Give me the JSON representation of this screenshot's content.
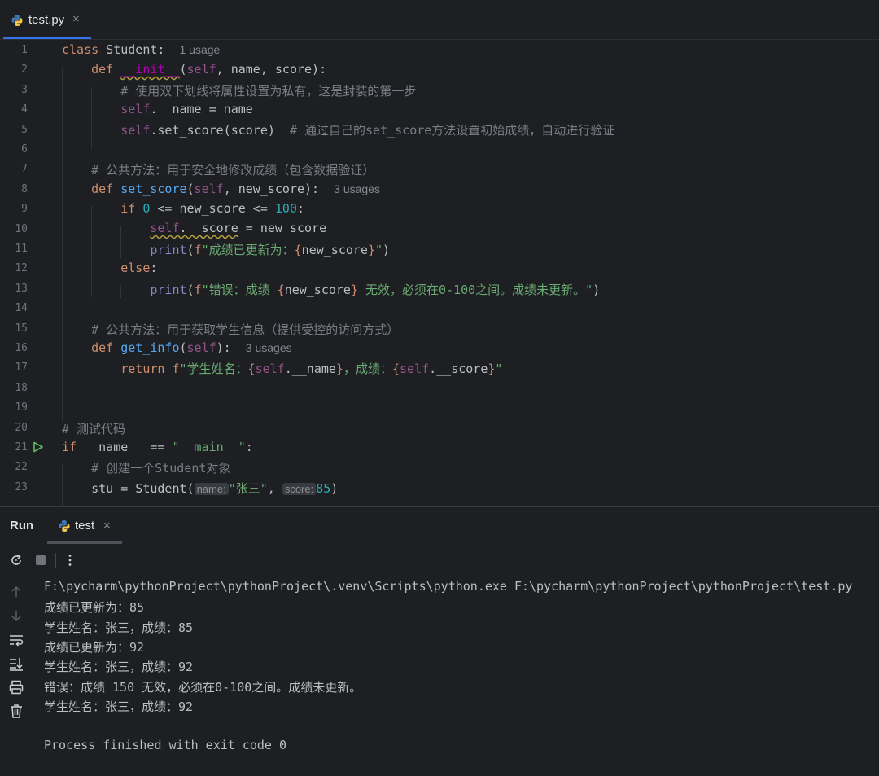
{
  "editor_tab": {
    "label": "test.py",
    "close": "×"
  },
  "gutter": [
    "1",
    "2",
    "3",
    "4",
    "5",
    "6",
    "7",
    "8",
    "9",
    "10",
    "11",
    "12",
    "13",
    "14",
    "15",
    "16",
    "17",
    "18",
    "19",
    "20",
    "21",
    "22",
    "23"
  ],
  "code": {
    "l1": {
      "kw": "class",
      "name": " Student:",
      "hint": "1 usage"
    },
    "l2": {
      "kw": "def",
      "sp": " ",
      "init": "__init__",
      "p1": "(",
      "self": "self",
      "rest": ", name, score):"
    },
    "l3": {
      "comment": "# 使用双下划线将属性设置为私有，这是封装的第一步"
    },
    "l4": {
      "self": "self",
      "rest": ".__name = name"
    },
    "l5": {
      "self": "self",
      "rest": ".set_score(score)",
      "comment": "# 通过自己的set_score方法设置初始成绩，自动进行验证"
    },
    "l7": {
      "comment": "# 公共方法：用于安全地修改成绩（包含数据验证）"
    },
    "l8": {
      "kw": "def",
      "fn": "set_score",
      "p1": "(",
      "self": "self",
      "rest": ", new_score):",
      "hint": "3 usages"
    },
    "l9": {
      "kw": "if",
      "num0": "0",
      "mid": " <= new_score <= ",
      "num100": "100",
      "end": ":"
    },
    "l10": {
      "self": "self",
      "rest": ".__score",
      "tail": " = new_score"
    },
    "l11": {
      "print": "print",
      "p1": "(",
      "f": "f",
      "str1": "\"成绩已更新为：",
      "lb": "{",
      "var": "new_score",
      "rb": "}",
      "str2": "\"",
      "p2": ")"
    },
    "l12": {
      "kw": "else",
      "end": ":"
    },
    "l13": {
      "print": "print",
      "p1": "(",
      "f": "f",
      "str1": "\"错误：成绩 ",
      "lb": "{",
      "var": "new_score",
      "rb": "}",
      "str2": " 无效，必须在0-100之间。成绩未更新。\"",
      "p2": ")"
    },
    "l15": {
      "comment": "# 公共方法：用于获取学生信息（提供受控的访问方式）"
    },
    "l16": {
      "kw": "def",
      "fn": "get_info",
      "p1": "(",
      "self": "self",
      "rest": "):",
      "hint": "3 usages"
    },
    "l17": {
      "kw": "return",
      "f": " f",
      "str1": "\"学生姓名：",
      "lb1": "{",
      "self1": "self",
      "v1": ".__name",
      "rb1": "}",
      "str2": "，成绩：",
      "lb2": "{",
      "self2": "self",
      "v2": ".__score",
      "rb2": "}",
      "str3": "\""
    },
    "l20": {
      "comment": "# 测试代码"
    },
    "l21": {
      "kw": "if",
      "mid": " __name__ == ",
      "str": "\"__main__\"",
      "end": ":"
    },
    "l22": {
      "comment": "# 创建一个Student对象"
    },
    "l23": {
      "a": "stu = Student(",
      "hint1": "name:",
      "str": "\"张三\"",
      "comma": ",",
      "hint2": "score:",
      "num": "85",
      "end": ")"
    }
  },
  "run_panel": {
    "title": "Run",
    "tab_label": "test",
    "tab_close": "×",
    "console": [
      "F:\\pycharm\\pythonProject\\pythonProject\\.venv\\Scripts\\python.exe F:\\pycharm\\pythonProject\\pythonProject\\test.py",
      "成绩已更新为：85",
      "学生姓名：张三，成绩：85",
      "成绩已更新为：92",
      "学生姓名：张三，成绩：92",
      "错误：成绩 150 无效，必须在0-100之间。成绩未更新。",
      "学生姓名：张三，成绩：92",
      "",
      "Process finished with exit code 0"
    ]
  },
  "icons": {
    "rerun": "rerun-icon",
    "stop": "stop-icon",
    "more": "more-vertical-icon",
    "up": "arrow-up-icon",
    "down": "arrow-down-icon",
    "wrap": "soft-wrap-icon",
    "scroll_end": "scroll-to-end-icon",
    "print": "print-icon",
    "trash": "trash-icon",
    "run_gutter": "run-gutter-icon"
  },
  "colors": {
    "keyword": "#cf8e6d",
    "function": "#56a8f5",
    "string": "#6aab73",
    "number": "#2aacb8",
    "comment": "#7a7e85",
    "self": "#94558d",
    "accent": "#3574f0"
  }
}
